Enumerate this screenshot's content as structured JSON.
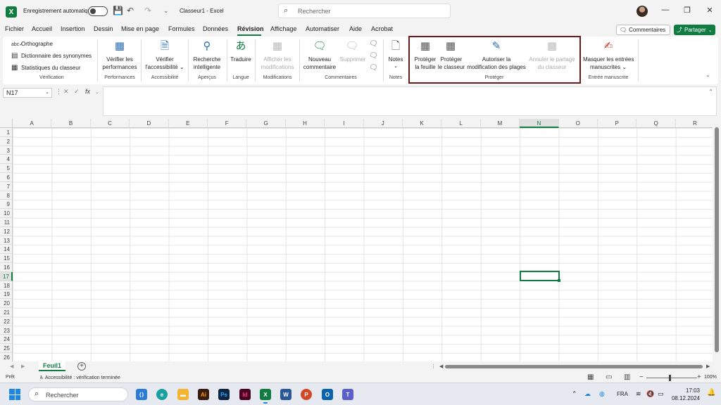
{
  "titlebar": {
    "app_icon": "X",
    "autosave_label": "Enregistrement automatique",
    "save_icon": "💾",
    "undo_icon": "↶",
    "redo_icon": "↷",
    "customize_icon": "⌄",
    "title": "Classeur1  -  Excel",
    "search_placeholder": "Rechercher",
    "minimize": "—",
    "maximize": "❐",
    "close": "✕"
  },
  "menu": {
    "items": [
      "Fichier",
      "Accueil",
      "Insertion",
      "Dessin",
      "Mise en page",
      "Formules",
      "Données",
      "Révision",
      "Affichage",
      "Automatiser",
      "Aide",
      "Acrobat"
    ],
    "comments": "Commentaires",
    "share": "Partager"
  },
  "ribbon": {
    "verification": {
      "spelling": "Orthographe",
      "thesaurus": "Dictionnaire des synonymes",
      "stats": "Statistiques du classeur",
      "label": "Vérification"
    },
    "performance": {
      "button_line1": "Vérifier les",
      "button_line2": "performances",
      "label": "Performances"
    },
    "accessibility": {
      "button_line1": "Vérifier",
      "button_line2": "l'accessibilité ⌄",
      "label": "Accessibilité"
    },
    "insights": {
      "button_line1": "Recherche",
      "button_line2": "intelligente",
      "label": "Aperçus"
    },
    "language": {
      "button": "Traduire",
      "label": "Langue"
    },
    "changes": {
      "button_line1": "Afficher les",
      "button_line2": "modifications",
      "label": "Modifications"
    },
    "comments": {
      "new_line1": "Nouveau",
      "new_line2": "commentaire",
      "delete": "Supprimer",
      "label": "Commentaires"
    },
    "notes": {
      "button": "Notes",
      "arrow": "⌄",
      "label": "Notes"
    },
    "protect": {
      "sheet_line1": "Protéger",
      "sheet_line2": "la feuille",
      "workbook_line1": "Protéger",
      "workbook_line2": "le classeur",
      "allow_line1": "Autoriser la",
      "allow_line2": "modification des plages",
      "unshare_line1": "Annuler le partage",
      "unshare_line2": "du classeur",
      "label": "Protéger"
    },
    "ink": {
      "button_line1": "Masquer les entrées",
      "button_line2": "manuscrites ⌄",
      "label": "Entrée manuscrite"
    }
  },
  "formula_bar": {
    "name_box": "N17",
    "fx": "fx"
  },
  "grid": {
    "columns": [
      "A",
      "B",
      "C",
      "D",
      "E",
      "F",
      "G",
      "H",
      "I",
      "J",
      "K",
      "L",
      "M",
      "N",
      "O",
      "P",
      "Q",
      "R"
    ],
    "rows": [
      "1",
      "2",
      "3",
      "4",
      "5",
      "6",
      "7",
      "8",
      "9",
      "10",
      "11",
      "12",
      "13",
      "14",
      "15",
      "16",
      "17",
      "18",
      "19",
      "20",
      "21",
      "22",
      "23",
      "24",
      "25",
      "26"
    ],
    "selected_column": "N",
    "selected_row": "17"
  },
  "sheets": {
    "active": "Feuil1",
    "add": "+"
  },
  "status": {
    "ready": "Prêt",
    "accessibility": "Accessibilité : vérification terminée",
    "zoom": "100%"
  },
  "taskbar": {
    "search": "Rechercher",
    "language": "FRA",
    "time": "17:03",
    "date": "08.12.2024"
  },
  "colors": {
    "accent": "#107c41",
    "protect_border": "#6d1a1a"
  }
}
